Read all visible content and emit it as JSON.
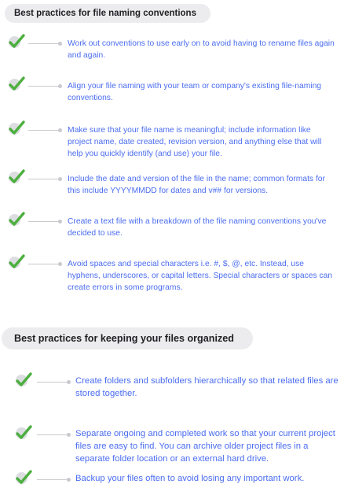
{
  "section1": {
    "title": "Best practices for file naming conventions",
    "items": [
      "Work out conventions to use early on to avoid having to rename files again and again.",
      "Align your file naming with your team or company's existing file-naming conventions.",
      "Make sure that your file name is meaningful; include information like project name, date created, revision version, and anything else that will help you quickly identify (and use) your file.",
      "Include the date and version of the file in the name; common formats for this include YYYYMMDD for dates and v## for versions.",
      "Create a text file with a breakdown of the file naming conventions you've decided to use.",
      "Avoid spaces and special characters i.e. #, $, @, etc. Instead, use hyphens, underscores, or capital letters. Special characters or spaces can create errors in some programs."
    ]
  },
  "section2": {
    "title": "Best practices for keeping your files organized",
    "items": [
      "Create folders and subfolders hierarchically so that related files are stored together.",
      "Separate ongoing and completed work so that your current project files are easy to find. You can archive older project files in a separate folder location or an external hard drive.",
      "Backup your files often to avoid losing any important work."
    ]
  },
  "colors": {
    "text": "#4a6cf0",
    "check": "#4caf3f",
    "pill": "#ececef"
  },
  "icons": [
    "checkmark-icon"
  ]
}
